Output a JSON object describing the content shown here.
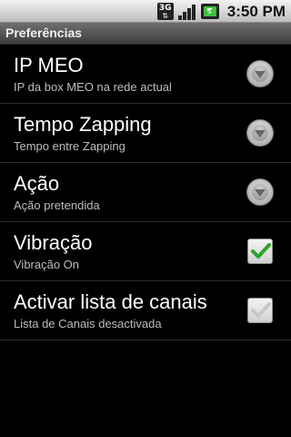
{
  "status_bar": {
    "network_type": "3G",
    "time": "3:50 PM",
    "icons": [
      "3g-icon",
      "signal-icon",
      "battery-icon"
    ],
    "signal_level": 1.0
  },
  "title_bar": {
    "title": "Preferências"
  },
  "preferences": [
    {
      "title": "IP MEO",
      "summary": "IP da box MEO na rede actual",
      "widget": "dropdown-icon"
    },
    {
      "title": "Tempo Zapping",
      "summary": "Tempo entre Zapping",
      "widget": "dropdown-icon"
    },
    {
      "title": "Ação",
      "summary": "Ação pretendida",
      "widget": "dropdown-icon"
    },
    {
      "title": "Vibração",
      "summary": "Vibração On",
      "widget": "checkbox",
      "checked": true
    },
    {
      "title": "Activar lista de canais",
      "summary": "Lista de Canais desactivada",
      "widget": "checkbox",
      "checked": false
    }
  ],
  "colors": {
    "checked_green": "#2aa52a",
    "unchecked_gray": "#c8c8c8"
  }
}
